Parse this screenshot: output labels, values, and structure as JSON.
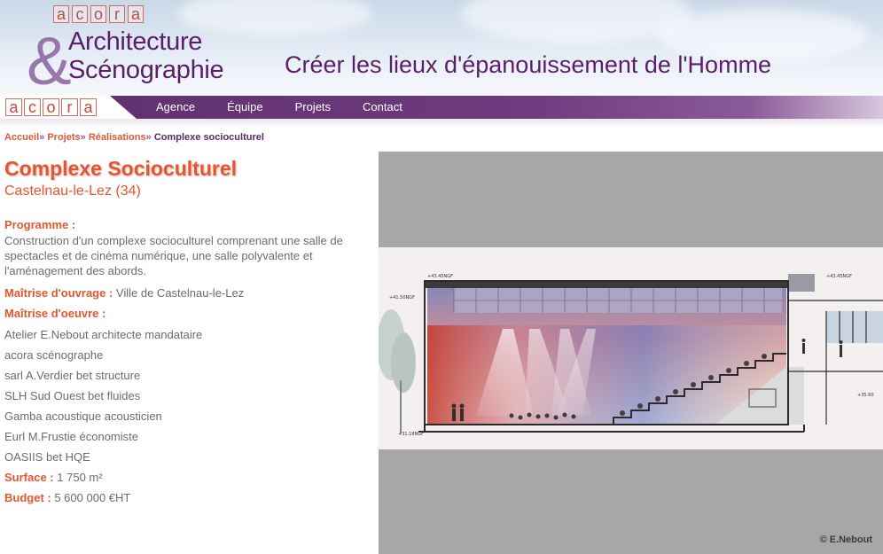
{
  "header": {
    "logo_letters": [
      "a",
      "c",
      "o",
      "r",
      "a"
    ],
    "ampersand": "&",
    "brand_line1": "Architecture",
    "brand_line2": "Scénographie",
    "tagline": "Créer les lieux d'épanouissement de l'Homme"
  },
  "nav": {
    "logo_letters": [
      "a",
      "c",
      "o",
      "r",
      "a"
    ],
    "items": [
      {
        "label": "Agence"
      },
      {
        "label": "Équipe"
      },
      {
        "label": "Projets"
      },
      {
        "label": "Contact"
      }
    ]
  },
  "breadcrumb": {
    "items": [
      {
        "label": "Accueil"
      },
      {
        "label": "Projets"
      },
      {
        "label": "Réalisations"
      }
    ],
    "separator": "»",
    "current": "Complexe socioculturel"
  },
  "project": {
    "title": "Complexe Socioculturel",
    "location": "Castelnau-le-Lez (34)",
    "programme_label": "Programme :",
    "programme_text": "Construction d'un complexe socioculturel comprenant une salle de spectacles et de cinéma numérique, une salle polyvalente et l'aménagement des abords.",
    "maitrise_ouvrage_label": "Maîtrise d'ouvrage :",
    "maitrise_ouvrage_value": "Ville de Castelnau-le-Lez",
    "maitrise_oeuvre_label": "Maîtrise d'oeuvre :",
    "team": [
      "Atelier E.Nebout architecte mandataire",
      "acora scénographe",
      "sarl A.Verdier bet structure",
      "SLH Sud Ouest bet fluides",
      "Gamba acoustique acousticien",
      "Eurl M.Frustie économiste",
      "OASIIS bet HQE"
    ],
    "surface_label": "Surface :",
    "surface_value": "1 750 m²",
    "budget_label": "Budget :",
    "budget_value": "5 600 000 €HT"
  },
  "image": {
    "credit": "© E.Nebout",
    "elevations": [
      "+43.45NGF",
      "+43.45NGF",
      "+41.50NGF",
      "+35.60",
      "+31.18NGF"
    ]
  },
  "colors": {
    "accent": "#e3562f",
    "brand_purple": "#5a1f68",
    "nav_purple": "#6f3b7e",
    "panel_gray": "#a7a7a7"
  }
}
